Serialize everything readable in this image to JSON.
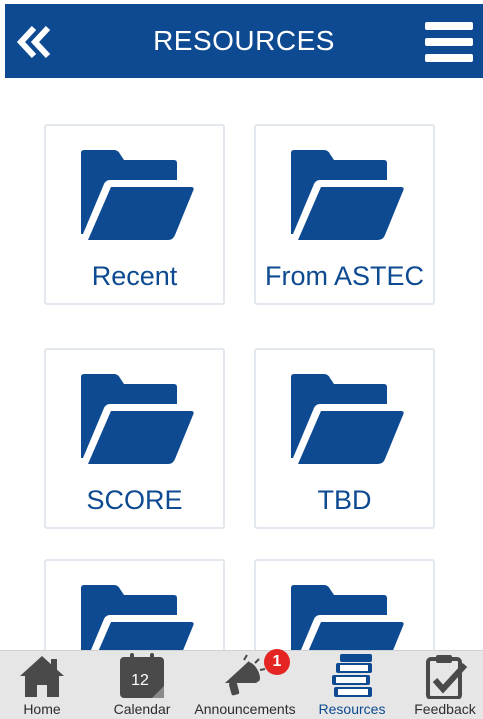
{
  "header": {
    "title": "RESOURCES",
    "back_icon": "double-chevron-left-icon",
    "menu_icon": "hamburger-menu-icon",
    "background_color": "#0d4a91"
  },
  "folders": [
    {
      "label": "Recent",
      "icon": "folder-open-icon"
    },
    {
      "label": "From ASTEC",
      "icon": "folder-open-icon"
    },
    {
      "label": "SCORE",
      "icon": "folder-open-icon"
    },
    {
      "label": "TBD",
      "icon": "folder-open-icon"
    },
    {
      "label": "",
      "icon": "folder-open-icon"
    },
    {
      "label": "",
      "icon": "folder-open-icon"
    }
  ],
  "folder_color": "#0d4a91",
  "tabbar": {
    "tabs": [
      {
        "label": "Home",
        "icon": "house-icon"
      },
      {
        "label": "Calendar",
        "icon": "calendar-icon",
        "day": "12"
      },
      {
        "label": "Announcements",
        "icon": "megaphone-icon",
        "badge": "1"
      },
      {
        "label": "Resources",
        "icon": "books-icon",
        "active": true
      },
      {
        "label": "Feedback",
        "icon": "clipboard-check-icon"
      }
    ]
  }
}
